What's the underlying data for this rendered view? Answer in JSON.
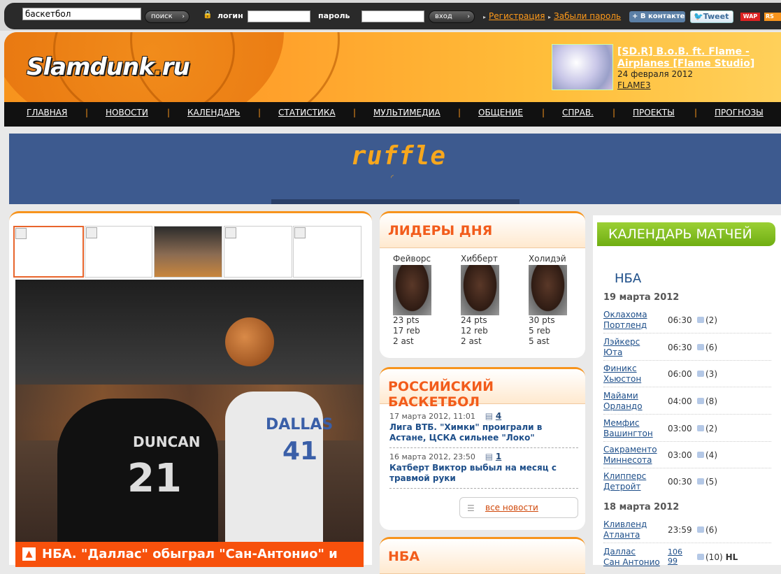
{
  "topbar": {
    "search_value": "баскетбол",
    "search_button": "поиск",
    "login_label": "логин",
    "password_label": "пароль",
    "enter_button": "вход",
    "register_link": "Регистрация",
    "forgot_link": "Забыли пароль",
    "vk_label": "В контакте",
    "tweet_label": "Tweet",
    "wap_label": "WAP",
    "rss_label": "RS"
  },
  "header": {
    "logo_main": "Slamdunk",
    "logo_dot": ".",
    "logo_tld": "ru",
    "promo_title": "[SD.R] B.o.B. ft. Flame - Airplanes [Flame Studio]",
    "promo_date": "24 февраля 2012",
    "promo_user": "FLAME3"
  },
  "nav": [
    "ГЛАВНАЯ",
    "НОВОСТИ",
    "КАЛЕНДАРЬ",
    "СТАТИСТИКА",
    "МУЛЬТИМЕДИА",
    "ОБЩЕНИЕ",
    "СПРАВ.",
    "ПРОЕКТЫ",
    "ПРОГНОЗЫ"
  ],
  "banner": {
    "logo": "ruffle"
  },
  "gallery": {
    "photo_texts": {
      "duncan": "DUNCAN",
      "num21": "21",
      "dallas": "DALLAS",
      "num41": "41"
    },
    "caption": "НБА. \"Даллас\" обыграл \"Сан-Антонио\" и",
    "caption_icon": "▲"
  },
  "leaders": {
    "title": "ЛИДЕРЫ ДНЯ",
    "players": [
      {
        "name": "Фейворс",
        "pts": "23 pts",
        "reb": "17 reb",
        "ast": "2 ast"
      },
      {
        "name": "Хибберт",
        "pts": "24 pts",
        "reb": "12 reb",
        "ast": "2 ast"
      },
      {
        "name": "Холидэй",
        "pts": "30 pts",
        "reb": "5 reb",
        "ast": "5 ast"
      }
    ]
  },
  "rusbb": {
    "title": "РОССИЙСКИЙ БАСКЕТБОЛ",
    "news": [
      {
        "date": "17 марта 2012, 11:01",
        "comments": "4",
        "headline": "Лига ВТБ. \"Химки\" проиграли в Астане, ЦСКА сильнее \"Локо\""
      },
      {
        "date": "16 марта 2012, 23:50",
        "comments": "1",
        "headline": "Катберт Виктор выбыл на месяц с травмой руки"
      }
    ],
    "all_news": "все новости"
  },
  "nba_panel": {
    "title": "НБА"
  },
  "calendar": {
    "title": "КАЛЕНДАРЬ МАТЧЕЙ",
    "league": "НБА",
    "days": [
      {
        "date": "19 марта 2012",
        "games": [
          {
            "home": "Оклахома",
            "away": "Портленд",
            "time": "06:30",
            "comments": "(2)"
          },
          {
            "home": "Лэйкерс",
            "away": "Юта",
            "time": "06:30",
            "comments": "(6)"
          },
          {
            "home": "Финикс",
            "away": "Хьюстон",
            "time": "06:00",
            "comments": "(3)"
          },
          {
            "home": "Майами",
            "away": "Орландо",
            "time": "04:00",
            "comments": "(8)"
          },
          {
            "home": "Мемфис",
            "away": "Вашингтон",
            "time": "03:00",
            "comments": "(2)"
          },
          {
            "home": "Сакраменто",
            "away": "Миннесота",
            "time": "03:00",
            "comments": "(4)"
          },
          {
            "home": "Клипперс",
            "away": "Детройт",
            "time": "00:30",
            "comments": "(5)"
          }
        ]
      },
      {
        "date": "18 марта 2012",
        "games": [
          {
            "home": "Кливленд",
            "away": "Атланта",
            "time": "23:59",
            "comments": "(6)"
          },
          {
            "home": "Даллас",
            "away": "Сан Антонио",
            "score_home": "106",
            "score_away": "99",
            "comments": "(10)",
            "hl": "HL"
          }
        ]
      }
    ]
  }
}
